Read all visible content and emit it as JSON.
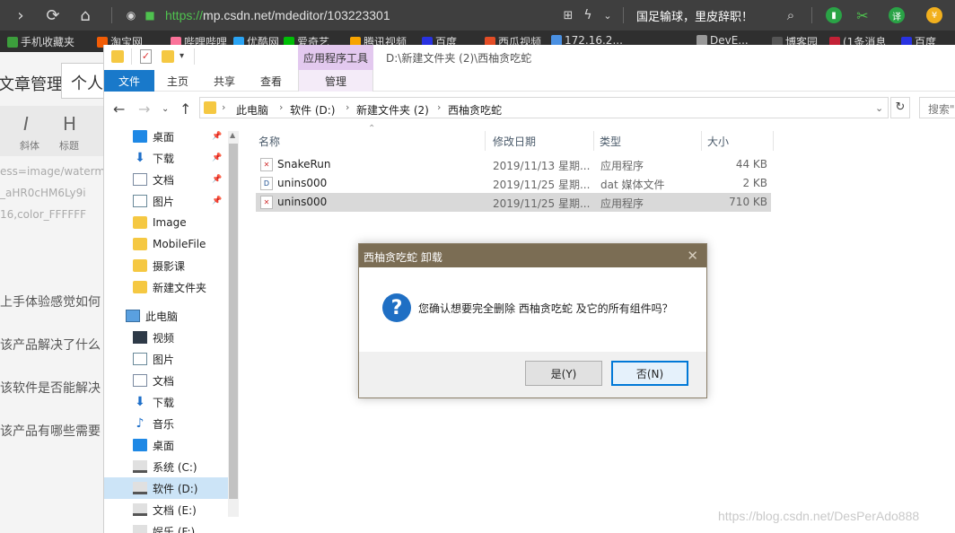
{
  "browser": {
    "url_scheme": "https://",
    "url_rest": "mp.csdn.net/mdeditor/103223301",
    "news": "国足输球，里皮辞职！"
  },
  "bookmarks": [
    {
      "label": "手机收藏夹",
      "color": "#3c9e3c"
    },
    {
      "label": "淘宝网",
      "color": "#f25c05"
    },
    {
      "label": "哔哩哔哩",
      "color": "#fb7299"
    },
    {
      "label": "优酷网",
      "color": "#2aa4f4"
    },
    {
      "label": "爱奇艺",
      "color": "#00be06"
    },
    {
      "label": "腾讯视频",
      "color": "#f7a400"
    },
    {
      "label": "百度",
      "color": "#2932e1"
    },
    {
      "label": "西瓜视频",
      "color": "#e44d26"
    },
    {
      "label": "172.16.2...",
      "color": "#4a90e2"
    },
    {
      "label": "DevE...",
      "color": "#999999"
    },
    {
      "label": "博客园",
      "color": "#555555"
    },
    {
      "label": "(1条消息",
      "color": "#c32136"
    },
    {
      "label": "百度",
      "color": "#2932e1"
    }
  ],
  "editor": {
    "title": "文章管理",
    "tab": "个人",
    "italic": "斜体",
    "heading": "标题",
    "code_lines": [
      "ess=image/waterm",
      "_aHR0cHM6Ly9i",
      "16,color_FFFFFF"
    ],
    "questions": [
      "上手体验感觉如何",
      "该产品解决了什么",
      "该软件是否能解决",
      "该产品有哪些需要"
    ]
  },
  "explorer": {
    "context_tool": "应用程序工具",
    "window_path": "D:\\新建文件夹 (2)\\西柚贪吃蛇",
    "tabs": {
      "file": "文件",
      "home": "主页",
      "share": "共享",
      "view": "查看",
      "manage": "管理"
    },
    "breadcrumbs": [
      "此电脑",
      "软件 (D:)",
      "新建文件夹 (2)",
      "西柚贪吃蛇"
    ],
    "search_placeholder": "搜索\"西",
    "nav": [
      {
        "label": "桌面",
        "icon": "desktop-icon",
        "pinned": true
      },
      {
        "label": "下载",
        "icon": "download-icon",
        "pinned": true
      },
      {
        "label": "文档",
        "icon": "document-icon",
        "pinned": true
      },
      {
        "label": "图片",
        "icon": "picture-icon",
        "pinned": true
      },
      {
        "label": "Image",
        "icon": "folder-icon",
        "pinned": false
      },
      {
        "label": "MobileFile",
        "icon": "folder-icon",
        "pinned": false
      },
      {
        "label": "摄影课",
        "icon": "folder-icon",
        "pinned": false
      },
      {
        "label": "新建文件夹",
        "icon": "folder-icon",
        "pinned": false
      },
      {
        "label": "此电脑",
        "icon": "computer-icon",
        "pinned": false
      },
      {
        "label": "视频",
        "icon": "video-icon",
        "pinned": false
      },
      {
        "label": "图片",
        "icon": "picture-icon",
        "pinned": false
      },
      {
        "label": "文档",
        "icon": "document-icon",
        "pinned": false
      },
      {
        "label": "下载",
        "icon": "download-icon",
        "pinned": false
      },
      {
        "label": "音乐",
        "icon": "music-icon",
        "pinned": false
      },
      {
        "label": "桌面",
        "icon": "desktop-icon",
        "pinned": false
      },
      {
        "label": "系统 (C:)",
        "icon": "drive-icon",
        "pinned": false
      },
      {
        "label": "软件 (D:)",
        "icon": "drive-icon",
        "pinned": false
      },
      {
        "label": "文档 (E:)",
        "icon": "drive-icon",
        "pinned": false
      },
      {
        "label": "娱乐 (F:)",
        "icon": "drive-icon",
        "pinned": false
      }
    ],
    "columns": {
      "name": "名称",
      "date": "修改日期",
      "type": "类型",
      "size": "大小"
    },
    "files": [
      {
        "name": "SnakeRun",
        "date": "2019/11/13 星期...",
        "type": "应用程序",
        "size": "44 KB",
        "icon": "exe-icon"
      },
      {
        "name": "unins000",
        "date": "2019/11/25 星期...",
        "type": "dat 媒体文件",
        "size": "2 KB",
        "icon": "dat-icon"
      },
      {
        "name": "unins000",
        "date": "2019/11/25 星期...",
        "type": "应用程序",
        "size": "710 KB",
        "icon": "exe-icon"
      }
    ]
  },
  "dialog": {
    "title": "西柚贪吃蛇 卸载",
    "message": "您确认想要完全删除 西柚贪吃蛇 及它的所有组件吗？",
    "yes": "是(Y)",
    "no": "否(N)"
  },
  "watermark": "https://blog.csdn.net/DesPerAdo888"
}
